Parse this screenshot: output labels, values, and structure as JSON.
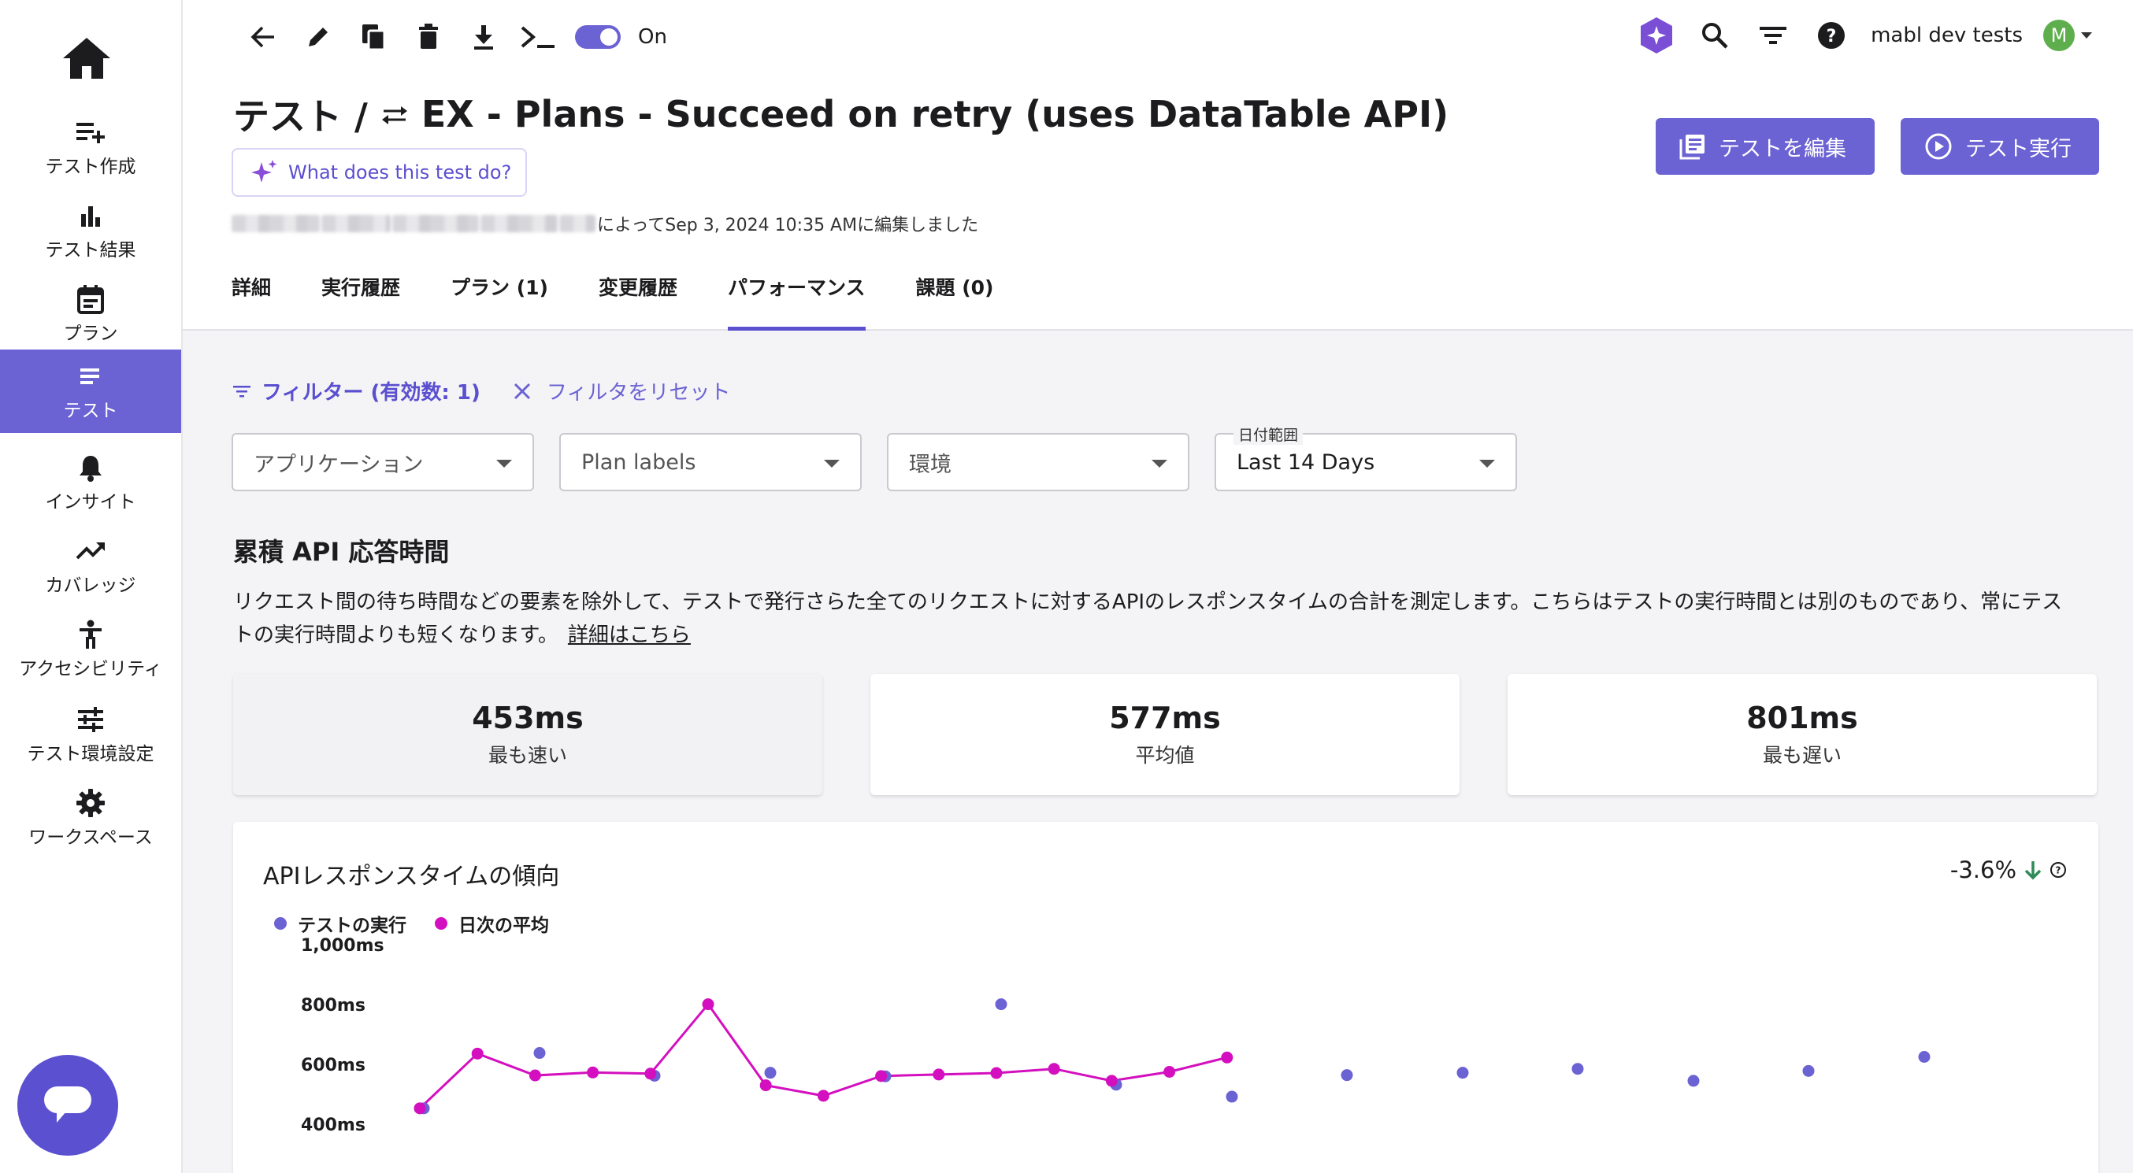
{
  "sidebar": {
    "items": [
      {
        "key": "create",
        "label": "テスト作成",
        "icon": "playlist-add-icon"
      },
      {
        "key": "results",
        "label": "テスト結果",
        "icon": "bar-chart-icon"
      },
      {
        "key": "plans",
        "label": "プラン",
        "icon": "calendar-icon"
      },
      {
        "key": "tests",
        "label": "テスト",
        "icon": "list-icon",
        "active": true
      },
      {
        "key": "insights",
        "label": "インサイト",
        "icon": "bell-icon"
      },
      {
        "key": "coverage",
        "label": "カバレッジ",
        "icon": "trending-up-icon"
      },
      {
        "key": "accessibility",
        "label": "アクセシビリティ",
        "icon": "accessibility-icon"
      },
      {
        "key": "env",
        "label": "テスト環境設定",
        "icon": "tune-icon"
      },
      {
        "key": "workspace",
        "label": "ワークスペース",
        "icon": "gear-icon"
      }
    ]
  },
  "toolbar": {
    "toggle_label": "On"
  },
  "topbar": {
    "workspace": "mabl dev tests",
    "avatar_initial": "M"
  },
  "test": {
    "breadcrumb": "テスト /",
    "name": "EX - Plans - Succeed on retry (uses DataTable API)",
    "ai_question": "What does this test do?",
    "edited_text": "によってSep 3, 2024 10:35 AMに編集しました"
  },
  "actions": {
    "edit": "テストを編集",
    "run": "テスト実行"
  },
  "tabs": [
    {
      "label": "詳細"
    },
    {
      "label": "実行履歴"
    },
    {
      "label": "プラン (1)"
    },
    {
      "label": "変更履歴"
    },
    {
      "label": "パフォーマンス",
      "active": true
    },
    {
      "label": "課題 (0)"
    }
  ],
  "filters": {
    "filter_label": "フィルター (有効数: 1)",
    "reset_label": "フィルタをリセット",
    "application": "アプリケーション",
    "plan_labels": "Plan labels",
    "environment": "環境",
    "date_range_label": "日付範囲",
    "date_range_value": "Last 14 Days"
  },
  "section": {
    "title": "累積 API 応答時間",
    "description": "リクエスト間の待ち時間などの要素を除外して、テストで発行さらた全てのリクエストに対するAPIのレスポンスタイムの合計を測定します。こちらはテストの実行時間とは別のものであり、常にテストの実行時間よりも短くなります。",
    "learn_more": "詳細はこちら"
  },
  "stats": [
    {
      "value": "453ms",
      "caption": "最も速い"
    },
    {
      "value": "577ms",
      "caption": "平均値"
    },
    {
      "value": "801ms",
      "caption": "最も遅い"
    }
  ],
  "chart_data": {
    "type": "scatter",
    "title": "APIレスポンスタイムの傾向",
    "trend": "-3.6%",
    "colors": {
      "runs": "#6b62d3",
      "daily": "#d40fbf",
      "trend_down": "#2e8b57"
    },
    "series": [
      {
        "name": "テストの実行",
        "values": [
          453,
          638,
          562,
          572,
          560,
          801,
          532,
          492,
          564,
          572,
          585,
          545,
          578,
          625
        ]
      },
      {
        "name": "日次の平均",
        "values": [
          453,
          636,
          563,
          573,
          569,
          801,
          530,
          495,
          561,
          566,
          571,
          585,
          545,
          575,
          623
        ]
      }
    ],
    "y_ticks": [
      "1,000ms",
      "800ms",
      "600ms",
      "400ms"
    ],
    "ylim": [
      400,
      1000
    ]
  }
}
